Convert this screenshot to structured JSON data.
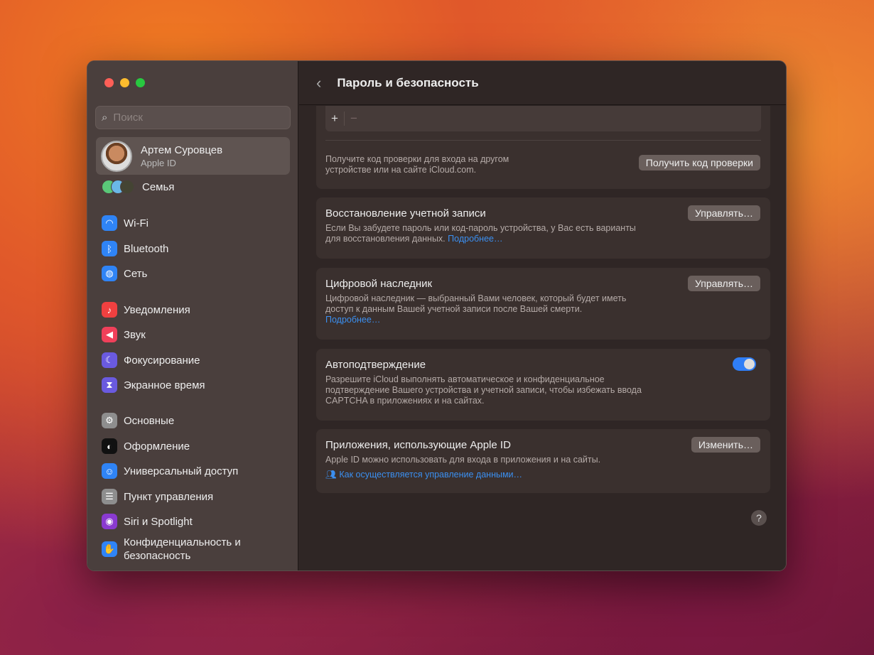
{
  "header": {
    "title": "Пароль и безопасность"
  },
  "sidebar": {
    "search_placeholder": "Поиск",
    "account": {
      "name": "Артем Суровцев",
      "sub": "Apple ID"
    },
    "family": "Семья",
    "items": [
      {
        "label": "Wi-Fi",
        "color": "#2f84f6",
        "icon": "wifi-icon"
      },
      {
        "label": "Bluetooth",
        "color": "#2f84f6",
        "icon": "bluetooth-icon"
      },
      {
        "label": "Сеть",
        "color": "#2f84f6",
        "icon": "globe-icon"
      },
      {
        "label": "Уведомления",
        "color": "#f04040",
        "icon": "bell-icon"
      },
      {
        "label": "Звук",
        "color": "#f0405a",
        "icon": "speaker-icon"
      },
      {
        "label": "Фокусирование",
        "color": "#6a5ae0",
        "icon": "moon-icon"
      },
      {
        "label": "Экранное время",
        "color": "#6a5ae0",
        "icon": "hourglass-icon"
      },
      {
        "label": "Основные",
        "color": "#8e8e8e",
        "icon": "gear-icon"
      },
      {
        "label": "Оформление",
        "color": "#111111",
        "icon": "appearance-icon"
      },
      {
        "label": "Универсальный доступ",
        "color": "#2f84f6",
        "icon": "accessibility-icon"
      },
      {
        "label": "Пункт управления",
        "color": "#8e8e8e",
        "icon": "control-center-icon"
      },
      {
        "label": "Siri и Spotlight",
        "color": "#8a3ad0",
        "icon": "siri-icon"
      },
      {
        "label": "Конфиденциальность и безопасность",
        "color": "#2f84f6",
        "icon": "hand-icon"
      }
    ]
  },
  "main": {
    "add": "+",
    "remove": "−",
    "verify": {
      "text": "Получите код проверки для входа на другом устройстве или на сайте iCloud.com.",
      "button": "Получить код проверки"
    },
    "recovery": {
      "title": "Восстановление учетной записи",
      "text": "Если Вы забудете пароль или код-пароль устройства, у Вас есть варианты для восстановления данных.",
      "link": "Подробнее…",
      "button": "Управлять…"
    },
    "legacy": {
      "title": "Цифровой наследник",
      "text": "Цифровой наследник — выбранный Вами человек, который будет иметь доступ к данным Вашей учетной записи после Вашей смерти.",
      "link": "Подробнее…",
      "button": "Управлять…"
    },
    "autoverify": {
      "title": "Автоподтверждение",
      "text": "Разрешите iCloud выполнять автоматическое и конфиденциальное подтверждение Вашего устройства и учетной записи, чтобы избежать ввода CAPTCHA в приложениях и на сайтах.",
      "enabled": true
    },
    "apps": {
      "title": "Приложения, использующие Apple ID",
      "text": "Apple ID можно использовать для входа в приложения и на сайты.",
      "link": "Как осуществляется управление данными…",
      "button": "Изменить…"
    },
    "help": "?"
  }
}
